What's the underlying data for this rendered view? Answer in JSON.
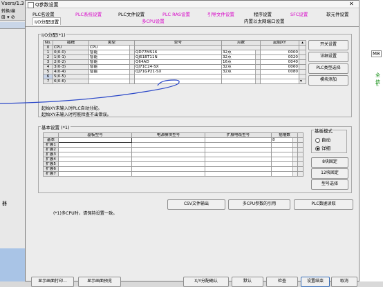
{
  "dialog_title": "Q参数设置",
  "background": {
    "left_top_text": "Vsers/1.3",
    "left_row_text": "转换/编",
    "left_mid_text": "器",
    "right_text_1": "M8",
    "right_text_2": "全信",
    "right_text_3": "Y."
  },
  "tabs_row1": [
    {
      "label": "PLC名设置",
      "pink": false
    },
    {
      "label": "PLC系统设置",
      "pink": true
    },
    {
      "label": "PLC文件设置",
      "pink": false
    },
    {
      "label": "PLC RAS设置",
      "pink": true
    },
    {
      "label": "引导文件设置",
      "pink": true
    },
    {
      "label": "程序设置",
      "pink": false
    },
    {
      "label": "SFC设置",
      "pink": true
    },
    {
      "label": "软元件设置",
      "pink": false
    }
  ],
  "tabs_row2": [
    {
      "label": "I/O分配设置",
      "pink": false
    },
    {
      "label": "多CPU设置",
      "pink": true
    },
    {
      "label": "内置以太网端口设置",
      "pink": false
    }
  ],
  "io": {
    "group_title": "I/O分配(*1)",
    "headers": {
      "no": "No.",
      "slot": "插槽",
      "type": "类型",
      "model": "型号",
      "points": "点数",
      "start": "起始XY"
    },
    "rows": [
      {
        "no": "0",
        "slot": "CPU",
        "type": "CPU",
        "model": "",
        "points": "",
        "start": ""
      },
      {
        "no": "1",
        "slot": "0(0-0)",
        "type": "智能",
        "model": "QD77MS16",
        "points": "32点",
        "start": "0000"
      },
      {
        "no": "2",
        "slot": "1(0-1)",
        "type": "智能",
        "model": "QJ61BT11N",
        "points": "32点",
        "start": "0020"
      },
      {
        "no": "3",
        "slot": "2(0-2)",
        "type": "智能",
        "model": "Q64AD",
        "points": "16点",
        "start": "0040"
      },
      {
        "no": "4",
        "slot": "3(0-3)",
        "type": "智能",
        "model": "QJ71C24-SX",
        "points": "32点",
        "start": "0060"
      },
      {
        "no": "5",
        "slot": "4(0-4)",
        "type": "智能",
        "model": "QJ71GP21-SX",
        "points": "32点",
        "start": "0080"
      },
      {
        "no": "6",
        "slot": "5(0-5)",
        "type": "",
        "model": "",
        "points": "",
        "start": ""
      },
      {
        "no": "7",
        "slot": "6(0-6)",
        "type": "",
        "model": "",
        "points": "",
        "start": ""
      }
    ],
    "note1": "起始XY未输入时PLC自动分配。",
    "note2": "起始XY未输入时可能检查不出错误。",
    "buttons": [
      "开关设置",
      "详细设置",
      "PLC类型选择",
      "模块添加"
    ]
  },
  "base": {
    "group_title": "基本设置 (*1)",
    "headers": {
      "base_model": "基板型号",
      "power_model": "电源模块型号",
      "ext_cable": "扩展电缆型号",
      "slots": "插槽数"
    },
    "rows": [
      {
        "label": "基本",
        "slots": "8"
      },
      {
        "label": "扩展1",
        "slots": ""
      },
      {
        "label": "扩展2",
        "slots": ""
      },
      {
        "label": "扩展3",
        "slots": ""
      },
      {
        "label": "扩展4",
        "slots": ""
      },
      {
        "label": "扩展5",
        "slots": ""
      },
      {
        "label": "扩展6",
        "slots": ""
      },
      {
        "label": "扩展7",
        "slots": ""
      }
    ],
    "mode_title": "基板模式",
    "mode_auto": "自动",
    "mode_detail": "详细",
    "mode_selected": "详细",
    "fixed_buttons": [
      "8块固定",
      "12块固定",
      "型号选择"
    ]
  },
  "bottom_buttons": [
    "CSV文件输出",
    "多CPU参数的引用",
    "PLC数据读取"
  ],
  "multi_cpu_note": "(*1)多CPU时，请保持设置一致。",
  "footer_buttons": [
    "显示画面打印...",
    "显示画面预览",
    "X/Y分配确认",
    "默认",
    "检查",
    "设置结束",
    "取消"
  ]
}
